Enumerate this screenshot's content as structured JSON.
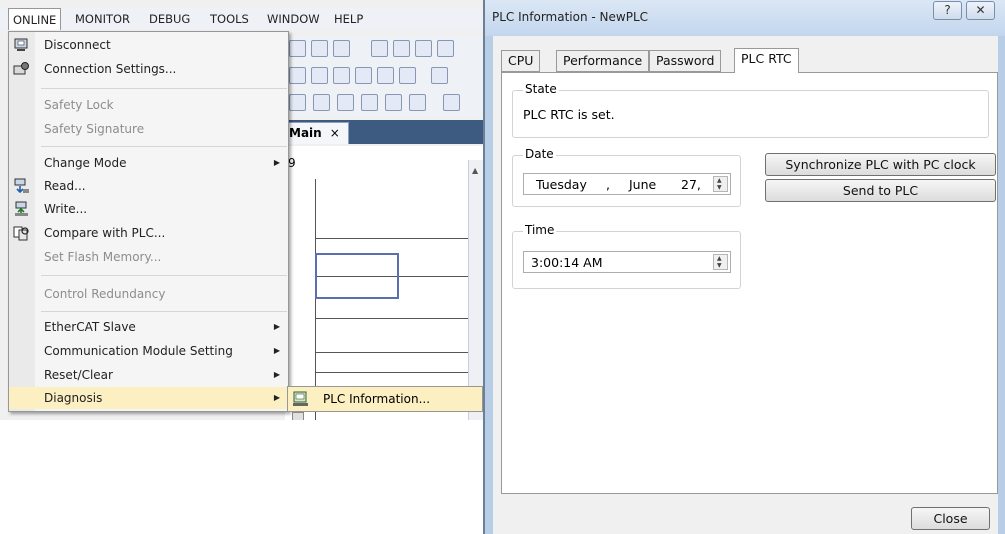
{
  "menubar": {
    "items": [
      "ONLINE",
      "MONITOR",
      "DEBUG",
      "TOOLS",
      "WINDOW",
      "HELP"
    ]
  },
  "online_menu": {
    "items": [
      {
        "label": "Disconnect",
        "icon": "disconnect-icon"
      },
      {
        "label": "Connection Settings...",
        "icon": "connection-settings-icon"
      },
      {
        "label": "Safety Lock"
      },
      {
        "label": "Safety Signature"
      },
      {
        "label": "Change Mode"
      },
      {
        "label": "Read...",
        "icon": "read-icon"
      },
      {
        "label": "Write...",
        "icon": "write-icon"
      },
      {
        "label": "Compare with PLC...",
        "icon": "compare-icon"
      },
      {
        "label": "Set Flash Memory..."
      },
      {
        "label": "Control Redundancy"
      },
      {
        "label": "EtherCAT Slave"
      },
      {
        "label": "Communication Module Setting"
      },
      {
        "label": "Reset/Clear"
      },
      {
        "label": "Diagnosis"
      }
    ]
  },
  "submenu": {
    "label": "PLC Information...",
    "icon": "plc-information-icon"
  },
  "editor": {
    "tab_label": "Main",
    "tab_close": "×",
    "row_number": "9"
  },
  "dialog": {
    "title": "PLC Information - NewPLC",
    "help_button": "?",
    "close_button": "✕",
    "tabs": [
      "CPU",
      "Performance",
      "Password",
      "PLC RTC"
    ],
    "active_tab": "PLC RTC",
    "state": {
      "title": "State",
      "text": "PLC RTC is set."
    },
    "date": {
      "title": "Date",
      "weekday": "Tuesday",
      "sep": ",",
      "month": "June",
      "day": "27,"
    },
    "time": {
      "title": "Time",
      "value": "3:00:14 AM"
    },
    "sync_button": "Synchronize PLC with PC clock",
    "send_button": "Send to PLC",
    "close_label": "Close"
  },
  "colors": {
    "highlight": "#fcefc2",
    "dialog_frame": "#b8cde6",
    "editor_tab_strip": "#3d5a80"
  }
}
